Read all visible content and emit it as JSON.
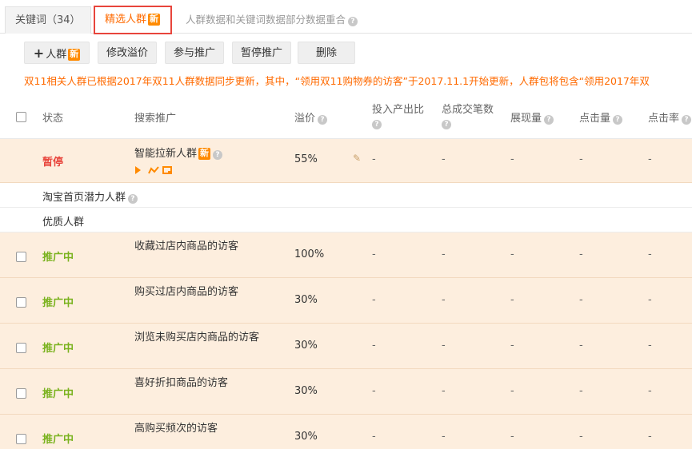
{
  "tabs": {
    "keywords_label": "关键词（34）",
    "selected_label": "精选人群",
    "selected_badge": "新",
    "merge_label": "人群数据和关键词数据部分数据重合"
  },
  "toolbar": {
    "add_label": "人群",
    "add_badge": "新",
    "modify_label": "修改溢价",
    "join_label": "参与推广",
    "pause_label": "暂停推广",
    "delete_label": "删除"
  },
  "notice": "双11相关人群已根据2017年双11人群数据同步更新，其中，“领用双11购物券的访客”于2017.11.1开始更新，人群包将包含“领用2017年双",
  "columns": {
    "status": "状态",
    "search": "搜索推广",
    "premium": "溢价",
    "roi": "投入产出比",
    "orders": "总成交笔数",
    "impressions": "展现量",
    "clicks": "点击量",
    "ctr": "点击率"
  },
  "smart_row": {
    "status": "暂停",
    "name": "智能拉新人群",
    "badge": "新",
    "premium": "55%",
    "roi": "-",
    "orders": "-",
    "impressions": "-",
    "clicks": "-",
    "ctr": "-"
  },
  "group_taobao": "淘宝首页潜力人群",
  "group_quality": "优质人群",
  "rows": [
    {
      "status": "推广中",
      "name": "收藏过店内商品的访客",
      "premium": "100%",
      "roi": "-",
      "orders": "-",
      "impressions": "-",
      "clicks": "-",
      "ctr": "-"
    },
    {
      "status": "推广中",
      "name": "购买过店内商品的访客",
      "premium": "30%",
      "roi": "-",
      "orders": "-",
      "impressions": "-",
      "clicks": "-",
      "ctr": "-"
    },
    {
      "status": "推广中",
      "name": "浏览未购买店内商品的访客",
      "premium": "30%",
      "roi": "-",
      "orders": "-",
      "impressions": "-",
      "clicks": "-",
      "ctr": "-"
    },
    {
      "status": "推广中",
      "name": "喜好折扣商品的访客",
      "premium": "30%",
      "roi": "-",
      "orders": "-",
      "impressions": "-",
      "clicks": "-",
      "ctr": "-"
    },
    {
      "status": "推广中",
      "name": "高购买频次的访客",
      "premium": "30%",
      "roi": "-",
      "orders": "-",
      "impressions": "-",
      "clicks": "-",
      "ctr": "-"
    }
  ],
  "colors": {
    "accent": "#ff6a00",
    "pause": "#e8453c",
    "active": "#7ab21e",
    "row_highlight": "#fdeede"
  }
}
